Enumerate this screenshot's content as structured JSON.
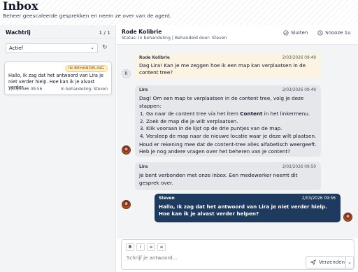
{
  "page": {
    "title": "Inbox",
    "subtitle": "Beheer geescaleerde gesprekken en neem ze over van de agent."
  },
  "queue": {
    "title": "Wachtrij",
    "count": "1 / 1",
    "filter_value": "Actief",
    "items": [
      {
        "badge": "IN BEHANDELING",
        "preview": "Hallo, Ik zag dat het antwoord van Lira je niet verder hielp. Hoe kan ik je alvast verder...",
        "date": "2/03/2026 09:56",
        "status": "In behandeling: Steven"
      }
    ]
  },
  "conversation": {
    "name": "Rode Kolibrie",
    "status": "Status: In behandeling | Behandeld door: Steven",
    "close_label": "Sluiten",
    "snooze_label": "Snooze 1u",
    "messages": [
      {
        "author": "Rode Kolibrie",
        "time": "2/03/2026 09:49",
        "text": "Dag Lira! Kan je me zeggen hoe ik een map kan verplaatsen in de content tree?",
        "avatar": "R"
      },
      {
        "author": "Lira",
        "time": "2/03/2026 09:49",
        "intro": "Dag! Om een map te verplaatsen in de content tree, volg je deze stappen:",
        "steps": [
          {
            "before": "Ga naar de content tree via het item ",
            "bold": "Content",
            "after": " in het linkermenu."
          },
          {
            "before": "Zoek de map die je wilt verplaatsen.",
            "bold": "",
            "after": ""
          },
          {
            "before": "Klik vooraan in de lijst op de drie puntjes van de map.",
            "bold": "",
            "after": ""
          },
          {
            "before": "Versleep de map naar de nieuwe locatie waar je deze wilt plaatsen.",
            "bold": "",
            "after": ""
          }
        ],
        "outro": "Houd er rekening mee dat de content-tree alles alfabetisch weergeeft. Heb je nog andere vragen over het beheren van je content?"
      },
      {
        "author": "Lira",
        "time": "2/03/2026 09:50",
        "text": "Je bent verbonden met onze inbox. Een medewerker neemt dit gesprek over."
      },
      {
        "author": "Steven",
        "time": "2/03/2026 09:56",
        "text": "Hallo, Ik zag dat het antwoord van Lira je niet verder hielp. Hoe kan ik je alvast verder helpen?"
      }
    ]
  },
  "composer": {
    "placeholder": "Schrijf je antwoord...",
    "send_label": "Verzenden",
    "toolbar": [
      "B",
      "I",
      "ul",
      "ol"
    ]
  },
  "colors": {
    "user_bubble": "#fdf3e3",
    "agent_bubble": "#e5e7eb",
    "staff_bubble": "#1e3a5f",
    "badge_bg": "#fef3c7",
    "badge_text": "#92400e"
  }
}
